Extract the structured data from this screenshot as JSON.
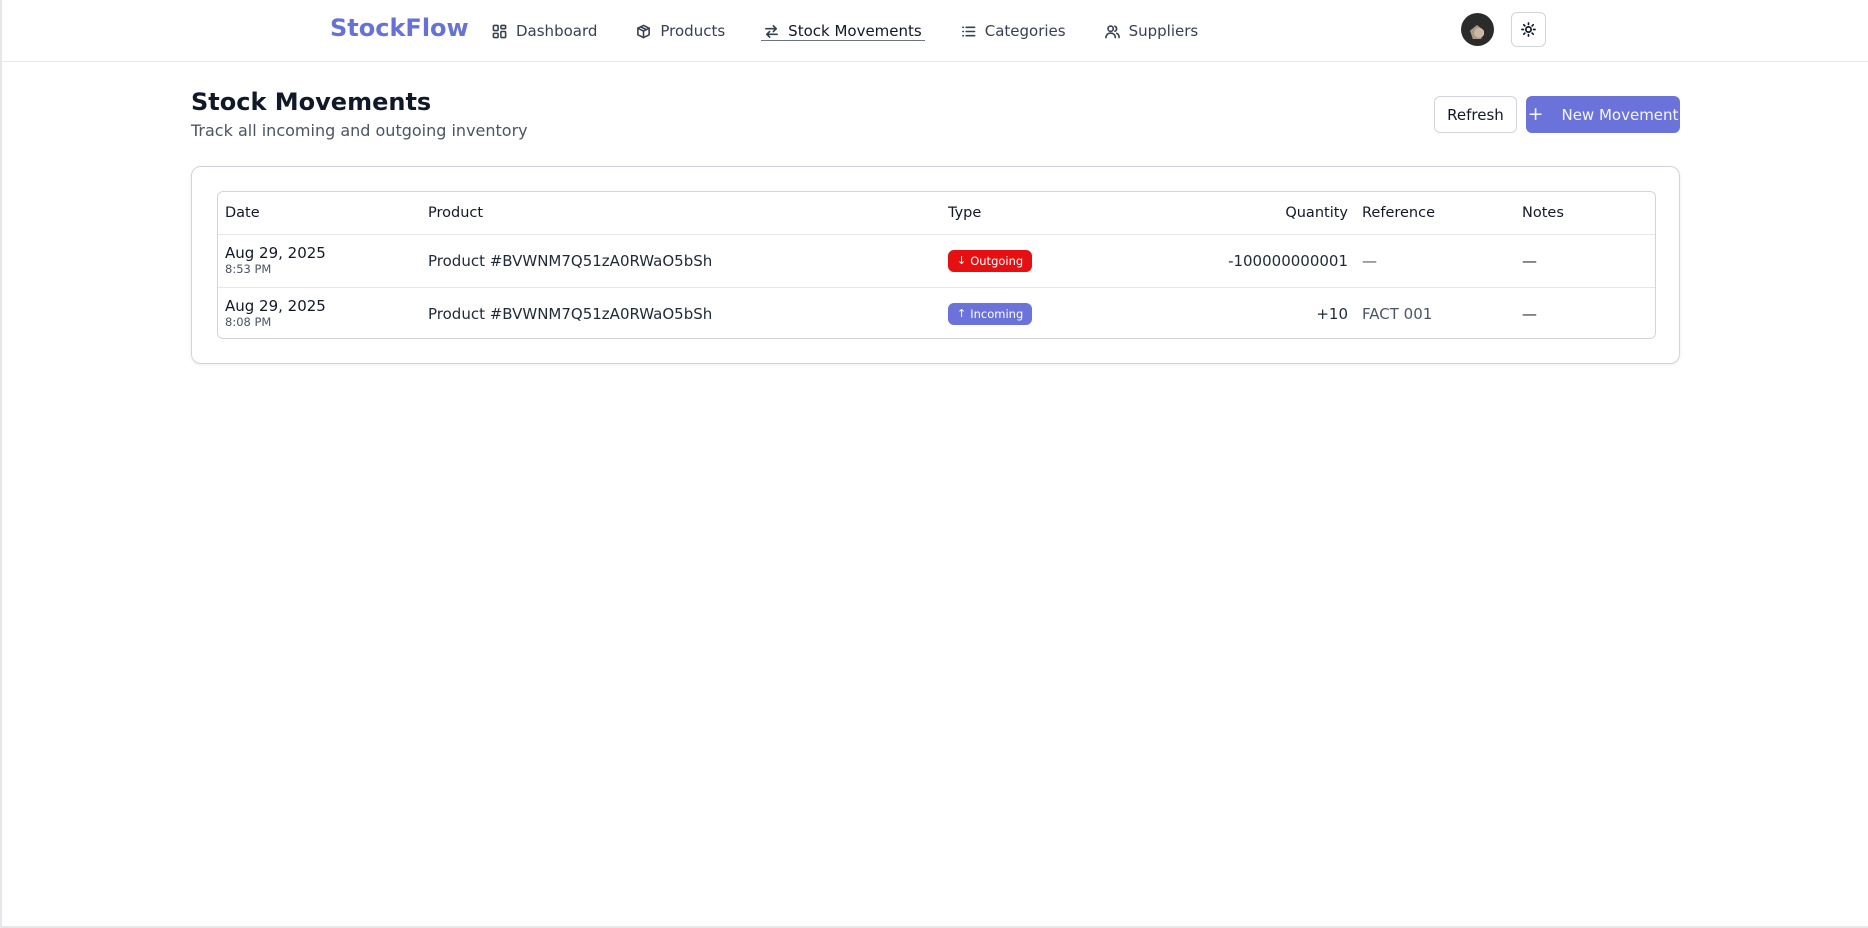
{
  "app": {
    "brand": "StockFlow",
    "accent_color": "#6b72d9"
  },
  "nav": {
    "items": [
      {
        "label": "Dashboard",
        "icon": "grid-icon",
        "active": false
      },
      {
        "label": "Products",
        "icon": "box-icon",
        "active": false
      },
      {
        "label": "Stock Movements",
        "icon": "arrows-swap-icon",
        "active": true
      },
      {
        "label": "Categories",
        "icon": "list-icon",
        "active": false
      },
      {
        "label": "Suppliers",
        "icon": "users-icon",
        "active": false
      }
    ]
  },
  "header": {
    "title": "Stock Movements",
    "subtitle": "Track all incoming and outgoing inventory",
    "refresh_label": "Refresh",
    "new_label": "New Movement"
  },
  "table": {
    "columns": [
      "Date",
      "Product",
      "Type",
      "Quantity",
      "Reference",
      "Notes"
    ],
    "rows": [
      {
        "date": "Aug 29, 2025",
        "time": "8:53 PM",
        "product": "Product #BVWNM7Q51zA0RWaO5bSh",
        "type": "Outgoing",
        "type_color": "#e60f12",
        "quantity": "-100000000001",
        "reference": "—",
        "notes": "—"
      },
      {
        "date": "Aug 29, 2025",
        "time": "8:08 PM",
        "product": "Product #BVWNM7Q51zA0RWaO5bSh",
        "type": "Incoming",
        "type_color": "#6b72d9",
        "quantity": "+10",
        "reference": "FACT 001",
        "notes": "—"
      }
    ]
  }
}
